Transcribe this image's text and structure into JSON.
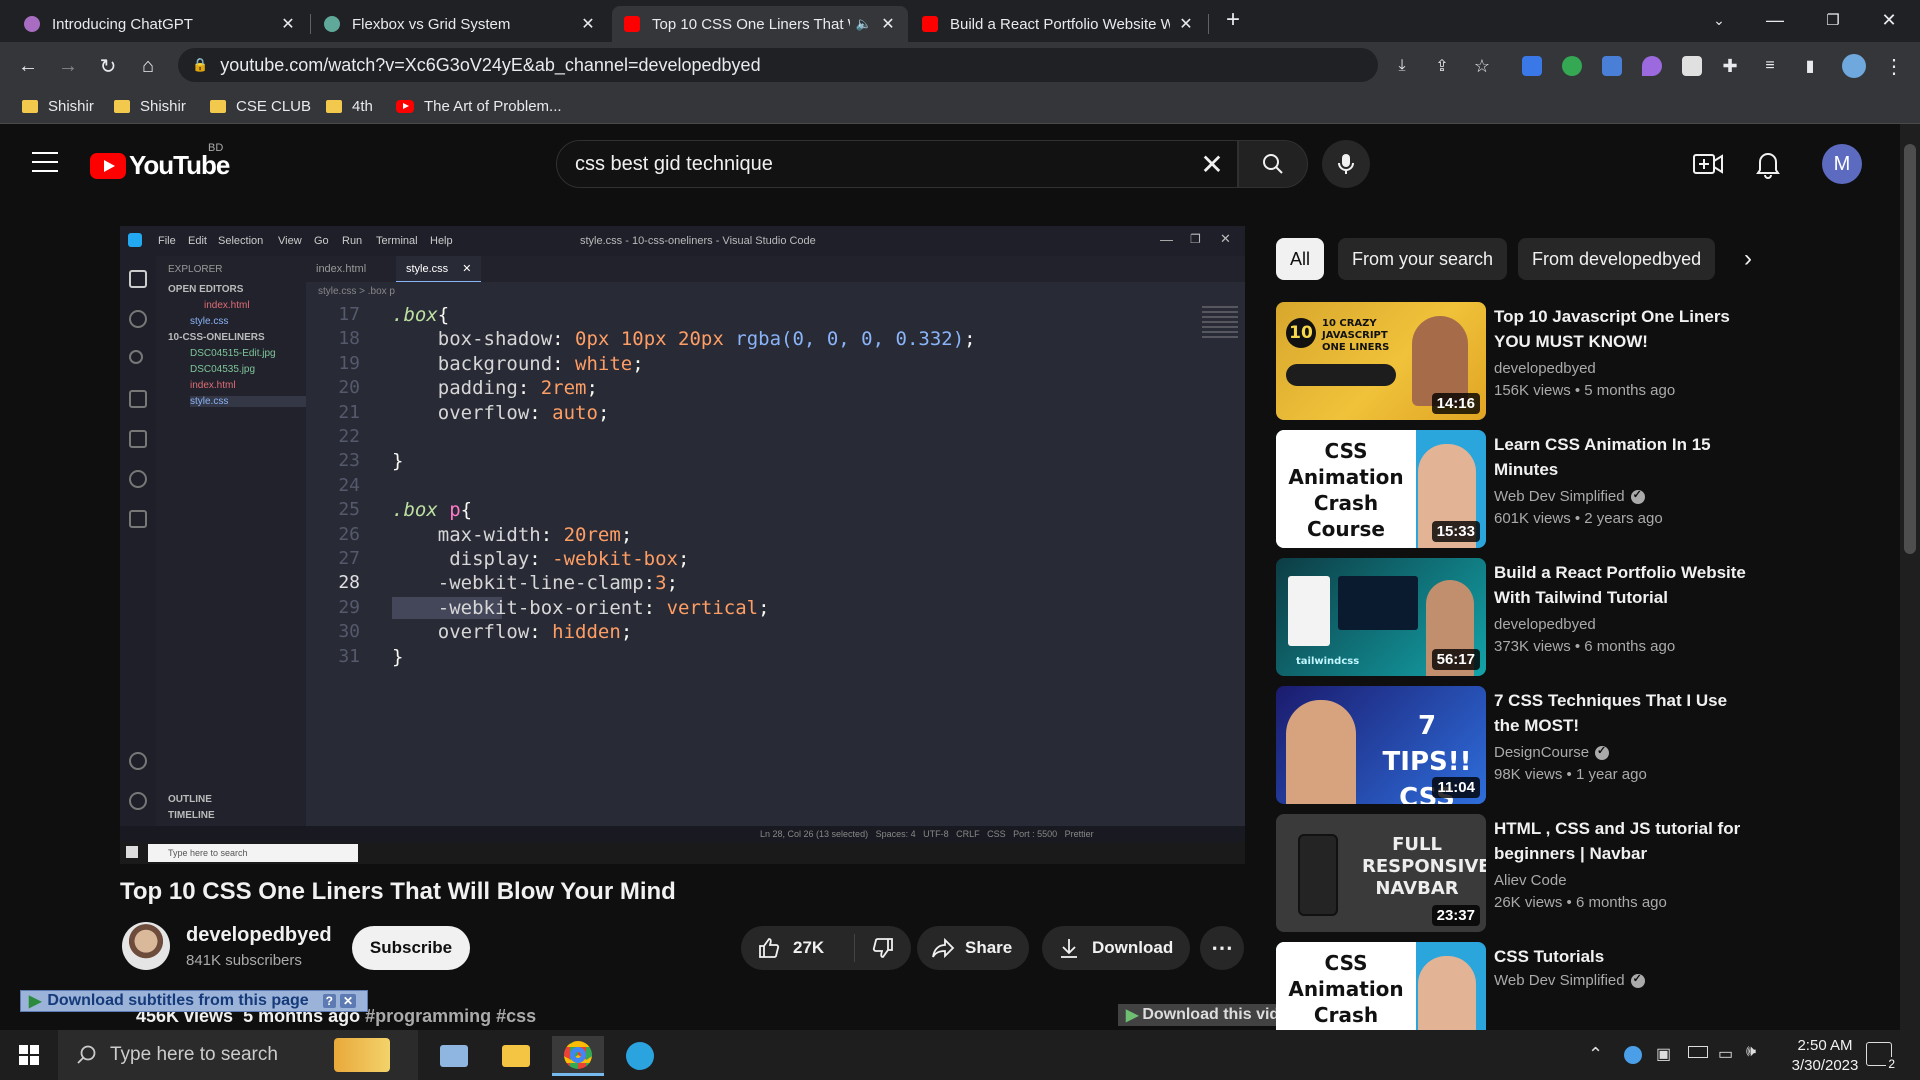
{
  "browser": {
    "tabs": [
      {
        "title": "Introducing ChatGPT",
        "favicon_color": "#a86cc1",
        "active": false
      },
      {
        "title": "Flexbox vs Grid System",
        "favicon_color": "#5fa89a",
        "active": false
      },
      {
        "title": "Top 10 CSS One Liners That W",
        "favicon_color": "#ff0000",
        "active": true
      },
      {
        "title": "Build a React Portfolio Website W",
        "favicon_color": "#ff0000",
        "active": false
      }
    ],
    "url": "youtube.com/watch?v=Xc6G3oV24yE&ab_channel=developedbyed",
    "bookmarks": [
      "Shishir",
      "Shishir",
      "CSE CLUB",
      "4th",
      "The Art of Problem..."
    ]
  },
  "youtube": {
    "logo_text": "YouTube",
    "country_code": "BD",
    "search_query": "css best gid technique",
    "avatar_letter": "M"
  },
  "player": {
    "vscode": {
      "menu": [
        "File",
        "Edit",
        "Selection",
        "View",
        "Go",
        "Run",
        "Terminal",
        "Help"
      ],
      "window_title": "style.css - 10-css-oneliners - Visual Studio Code",
      "explorer_label": "EXPLORER",
      "open_editors_label": "OPEN EDITORS",
      "open_editors": [
        "index.html",
        "style.css"
      ],
      "folder_label": "10-CSS-ONELINERS",
      "files": [
        "DSC04515-Edit.jpg",
        "DSC04535.jpg",
        "index.html",
        "style.css"
      ],
      "outline_label": "OUTLINE",
      "timeline_label": "TIMELINE",
      "tabs": [
        "index.html",
        "style.css"
      ],
      "breadcrumb": "style.css > .box p",
      "code_lines": [
        {
          "n": "17",
          "text": ".box{"
        },
        {
          "n": "18",
          "text": "    box-shadow: 0px 10px 20px rgba(0, 0, 0, 0.332);"
        },
        {
          "n": "19",
          "text": "    background: white;"
        },
        {
          "n": "20",
          "text": "    padding: 2rem;"
        },
        {
          "n": "21",
          "text": "    overflow: auto;"
        },
        {
          "n": "22",
          "text": ""
        },
        {
          "n": "23",
          "text": "}"
        },
        {
          "n": "24",
          "text": ""
        },
        {
          "n": "25",
          "text": ".box p{"
        },
        {
          "n": "26",
          "text": "    max-width: 20rem;"
        },
        {
          "n": "27",
          "text": "     display: -webkit-box;"
        },
        {
          "n": "28",
          "text": "    -webkit-line-clamp:3;"
        },
        {
          "n": "29",
          "text": "    -webkit-box-orient: vertical;"
        },
        {
          "n": "30",
          "text": "    overflow: hidden;"
        },
        {
          "n": "31",
          "text": "}"
        }
      ],
      "status_right": "Ln 28, Col 26 (13 selected)   Spaces: 4   UTF-8   CRLF   CSS   Port : 5500   Prettier",
      "taskbar_search": "Type here to search"
    }
  },
  "video": {
    "title": "Top 10 CSS One Liners That Will Blow Your Mind",
    "channel": "developedbyed",
    "subscribers": "841K subscribers",
    "subscribe_label": "Subscribe",
    "likes": "27K",
    "share_label": "Share",
    "download_label": "Download",
    "views": "456K views  5 months ago",
    "tags": "#programming #css",
    "dl_subtitles": "Download subtitles from this page",
    "dl_video": "Download this video"
  },
  "chips": [
    "All",
    "From your search",
    "From developedbyed"
  ],
  "recommended": [
    {
      "title": "Top 10 Javascript One Liners YOU MUST KNOW!",
      "channel": "developedbyed",
      "verified": false,
      "meta": "156K views  •  5 months ago",
      "duration": "14:16",
      "thumb_text": "10 CRAZY JAVASCRIPT ONE LINERS"
    },
    {
      "title": "Learn CSS Animation In 15 Minutes",
      "channel": "Web Dev Simplified",
      "verified": true,
      "meta": "601K views  •  2 years ago",
      "duration": "15:33",
      "thumb_text": "CSS Animation Crash Course"
    },
    {
      "title": "Build a React Portfolio Website With Tailwind Tutorial",
      "channel": "developedbyed",
      "verified": false,
      "meta": "373K views  •  6 months ago",
      "duration": "56:17",
      "thumb_text": "tailwindcss"
    },
    {
      "title": "7 CSS Techniques That I Use the MOST!",
      "channel": "DesignCourse",
      "verified": true,
      "meta": "98K views  •  1 year ago",
      "duration": "11:04",
      "thumb_text": "7 TIPS!! CSS"
    },
    {
      "title": "HTML , CSS and JS tutorial for beginners | Navbar",
      "channel": "Aliev Code",
      "verified": false,
      "meta": "26K views  •  6 months ago",
      "duration": "23:37",
      "thumb_text": "FULL RESPONSIVE NAVBAR"
    },
    {
      "title": "CSS Tutorials",
      "channel": "Web Dev Simplified",
      "verified": true,
      "meta": "",
      "duration": "",
      "thumb_text": "CSS Animation Crash"
    }
  ],
  "taskbar": {
    "search_placeholder": "Type here to search",
    "time": "2:50 AM",
    "date": "3/30/2023",
    "notification_count": "2"
  }
}
